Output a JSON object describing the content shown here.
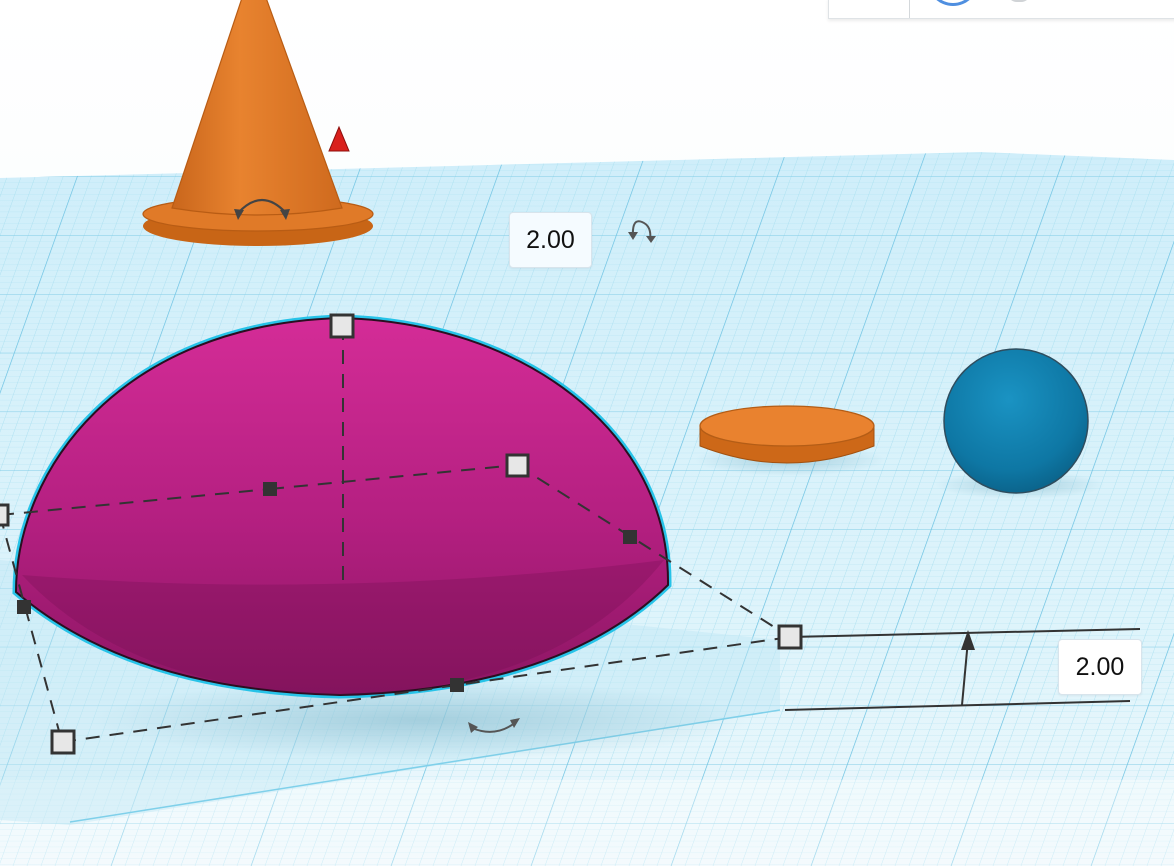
{
  "workplane": {
    "grid_color": "#8ed3ec",
    "plane_color": "#d9f1fb",
    "major_line_color": "#5bb9de"
  },
  "shapes": {
    "half_sphere": {
      "name": "half-sphere",
      "color": "#c8288f",
      "selected": true,
      "outline_color": "#27c3e8"
    },
    "cone": {
      "name": "cone",
      "color": "#e07a28"
    },
    "cylinder": {
      "name": "cylinder",
      "color": "#e07a28"
    },
    "sphere": {
      "name": "sphere",
      "color": "#117fab"
    }
  },
  "dimensions": {
    "top_value": "2.00",
    "height_value": "2.00"
  },
  "toolbar": {
    "avatar_icon": "user-avatar-icon",
    "help_icon": "help-icon"
  }
}
